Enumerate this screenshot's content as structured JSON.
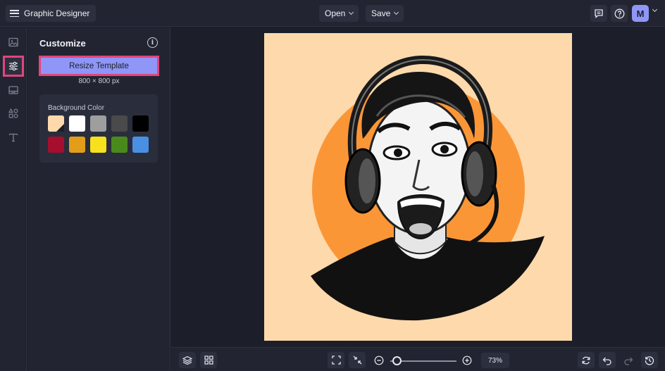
{
  "topbar": {
    "app_title": "Graphic Designer",
    "open_label": "Open",
    "save_label": "Save",
    "avatar_initial": "M"
  },
  "rail": {
    "items": [
      {
        "icon": "image-icon",
        "active": false
      },
      {
        "icon": "sliders-icon",
        "active": true
      },
      {
        "icon": "layout-icon",
        "active": false
      },
      {
        "icon": "shapes-icon",
        "active": false
      },
      {
        "icon": "text-icon",
        "active": false
      }
    ]
  },
  "panel": {
    "title": "Customize",
    "resize_button": "Resize Template",
    "size_label": "800 × 800 px",
    "background_label": "Background Color",
    "swatches": [
      "#fdd9ac",
      "#ffffff",
      "#9e9e9e",
      "#4a4a4a",
      "#000000",
      "#a50f2d",
      "#e39e19",
      "#f7e01d",
      "#4a8a1c",
      "#4a90e2"
    ],
    "selected_swatch": "#fdd9ac"
  },
  "canvas": {
    "artboard_color": "#fdd9ac",
    "circle_color": "#fb9637"
  },
  "bottombar": {
    "zoom_label": "73%",
    "zoom_value": 0.1
  },
  "colors": {
    "accent": "#8f96f7",
    "highlight": "#e0457e",
    "bg": "#1c1f2a"
  }
}
